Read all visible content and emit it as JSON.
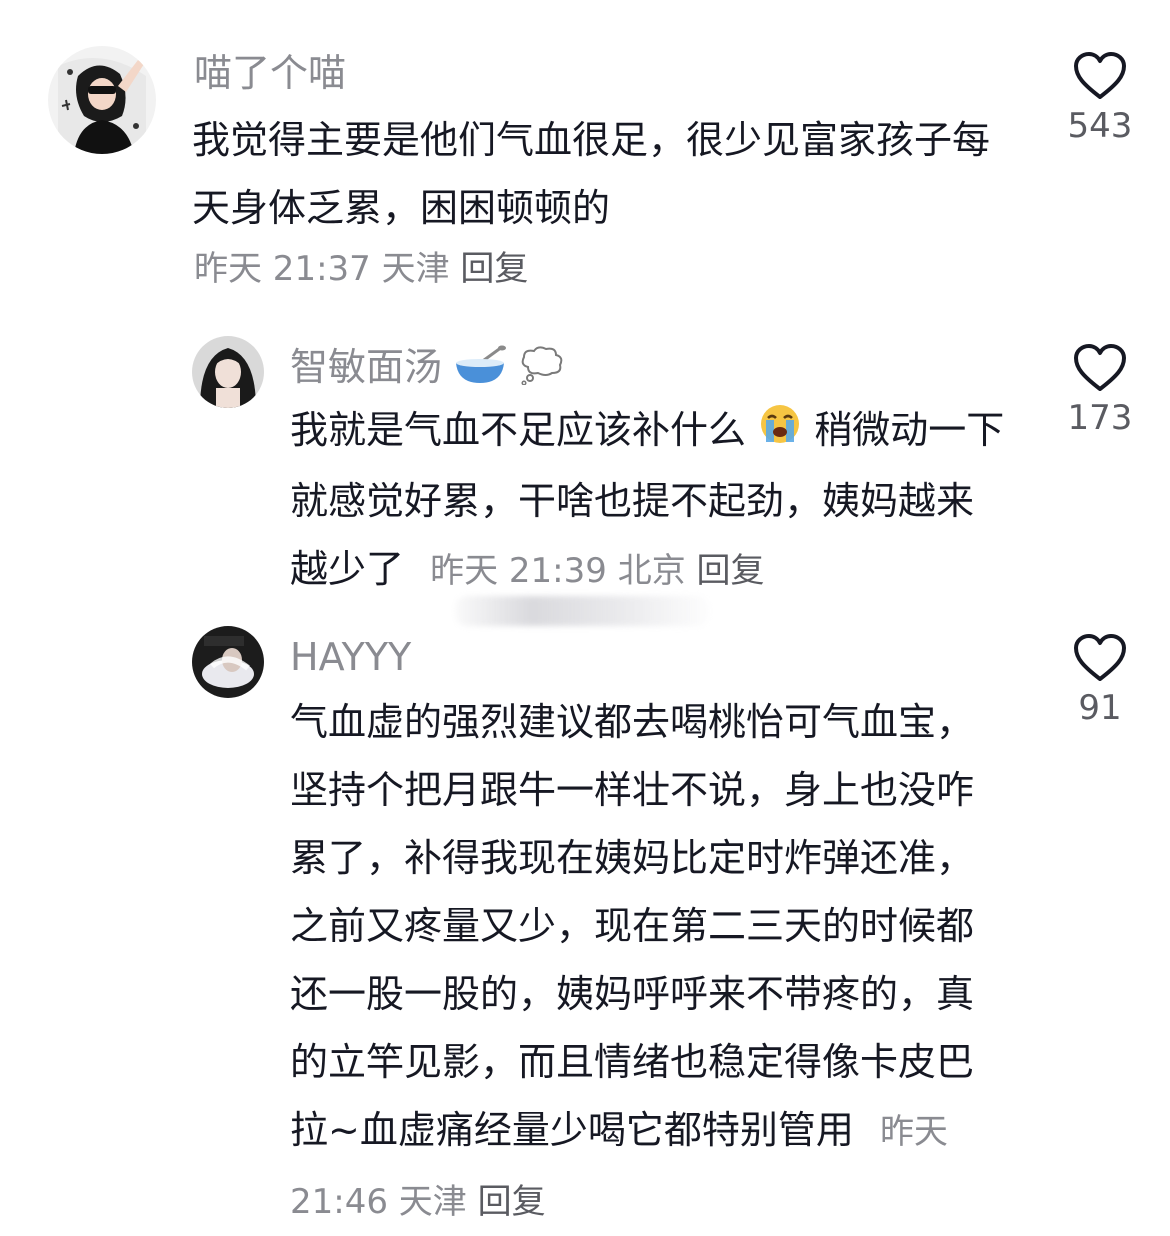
{
  "comments": [
    {
      "username": "喵了个喵",
      "text": "我觉得主要是他们气血很足，很少见富家孩子每天身体乏累，困困顿顿的",
      "time": "昨天 21:37",
      "location": "天津",
      "reply_label": "回复",
      "likes": "543"
    },
    {
      "username": "智敏面汤",
      "text_before_emoji": "我就是气血不足应该补什么",
      "text_after_emoji": "稍微动一下就感觉好累，干啥也提不起劲，姨妈越来越少了",
      "time": "昨天 21:39",
      "location": "北京",
      "reply_label": "回复",
      "likes": "173"
    },
    {
      "username": "HAYYY",
      "text": "气血虚的强烈建议都去喝桃怡可气血宝，坚持个把月跟牛一样壮不说，身上也没咋累了，补得我现在姨妈比定时炸弹还准，之前又疼量又少，现在第二三天的时候都还一股一股的，姨妈呼呼来不带疼的，真的立竿见影，而且情绪也稳定得像卡皮巴拉~血虚痛经量少喝它都特别管用",
      "time": "昨天 21:46",
      "location": "天津",
      "reply_label": "回复",
      "likes": "91"
    }
  ],
  "icons": {
    "like": "heart-outline-icon",
    "bowl": "bowl-spoon-emoji",
    "thought": "thought-bubble-emoji",
    "crying": "loudly-crying-face-emoji"
  },
  "colors": {
    "username": "#8a8b91",
    "body_text": "#161823",
    "meta": "#8a8b91"
  }
}
